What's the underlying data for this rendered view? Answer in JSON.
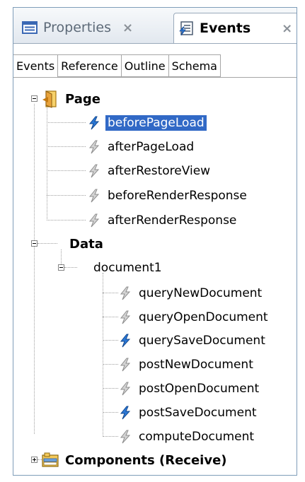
{
  "view_tabs": [
    {
      "label": "Properties",
      "active": false,
      "close": "×",
      "icon": "properties-icon"
    },
    {
      "label": "Events",
      "active": true,
      "close": "×",
      "icon": "events-icon"
    }
  ],
  "sub_tabs": [
    "Events",
    "Reference",
    "Outline",
    "Schema"
  ],
  "tree": {
    "page": {
      "label": "Page",
      "icon": "page-icon",
      "events": [
        {
          "label": "beforePageLoad",
          "selected": true,
          "has_code": true
        },
        {
          "label": "afterPageLoad",
          "selected": false,
          "has_code": false
        },
        {
          "label": "afterRestoreView",
          "selected": false,
          "has_code": false
        },
        {
          "label": "beforeRenderResponse",
          "selected": false,
          "has_code": false
        },
        {
          "label": "afterRenderResponse",
          "selected": false,
          "has_code": false
        }
      ]
    },
    "data": {
      "label": "Data",
      "document": {
        "label": "document1",
        "events": [
          {
            "label": "queryNewDocument",
            "has_code": false
          },
          {
            "label": "queryOpenDocument",
            "has_code": false
          },
          {
            "label": "querySaveDocument",
            "has_code": true
          },
          {
            "label": "postNewDocument",
            "has_code": false
          },
          {
            "label": "postOpenDocument",
            "has_code": false
          },
          {
            "label": "postSaveDocument",
            "has_code": true
          },
          {
            "label": "computeDocument",
            "has_code": false
          }
        ]
      }
    },
    "components": {
      "label": "Components (Receive)",
      "icon": "components-icon"
    }
  },
  "colors": {
    "selection": "#3169c6",
    "active_event_icon": "#2b78d6",
    "inactive_event_icon": "#b8b8b8"
  }
}
